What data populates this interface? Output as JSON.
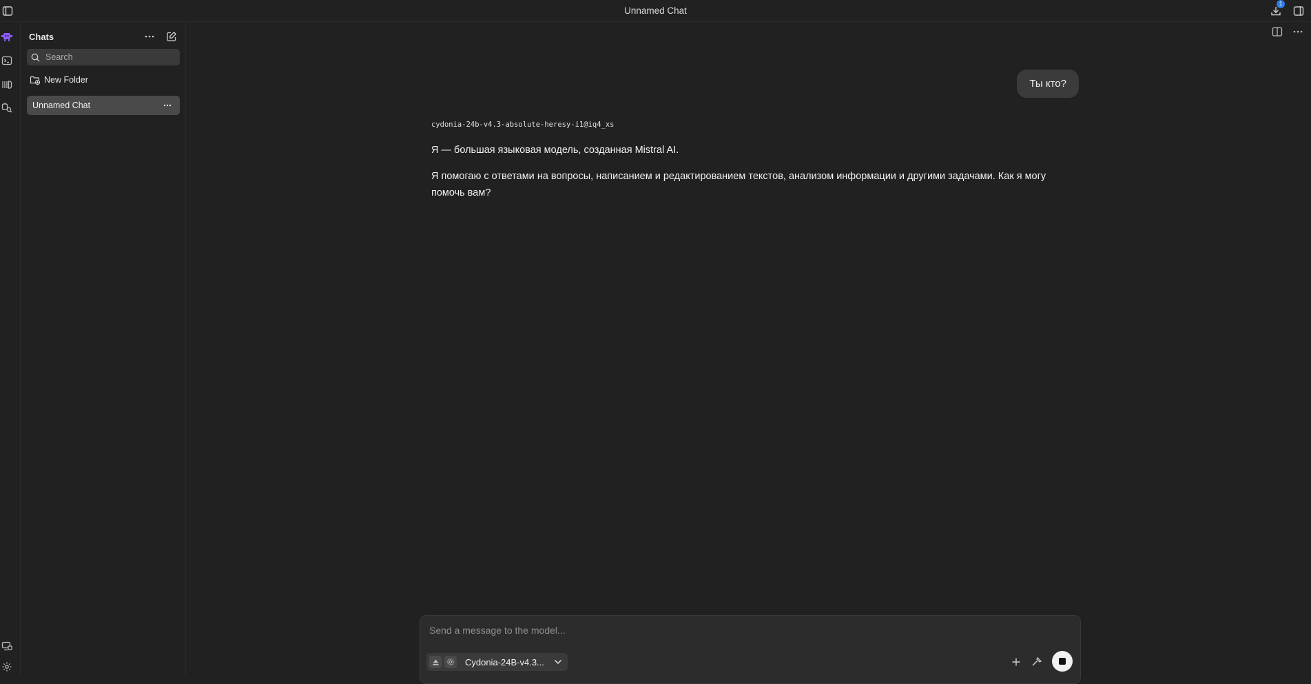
{
  "window": {
    "title": "Unnamed Chat",
    "downloads_badge": "1"
  },
  "rail": {
    "icons": [
      "app-logo-icon",
      "terminal-icon",
      "library-icon",
      "model-search-icon",
      "hardware-icon",
      "settings-icon"
    ],
    "accent_color": "#8b5cf6"
  },
  "sidebar": {
    "title": "Chats",
    "search_placeholder": "Search",
    "new_folder_label": "New Folder",
    "chats": [
      {
        "label": "Unnamed Chat",
        "selected": true
      }
    ]
  },
  "conversation": {
    "user_message": "Ты кто?",
    "model_name": "cydonia-24b-v4.3-absolute-heresy-i1@iq4_xs",
    "assistant_paragraphs": [
      "Я — большая языковая модель, созданная Mistral AI.",
      "Я помогаю с ответами на вопросы, написанием и редактированием текстов, анализом информации и другими задачами. Как я могу помочь вам?"
    ]
  },
  "composer": {
    "placeholder": "Send a message to the model...",
    "selected_model": "Cydonia-24B-v4.3..."
  }
}
